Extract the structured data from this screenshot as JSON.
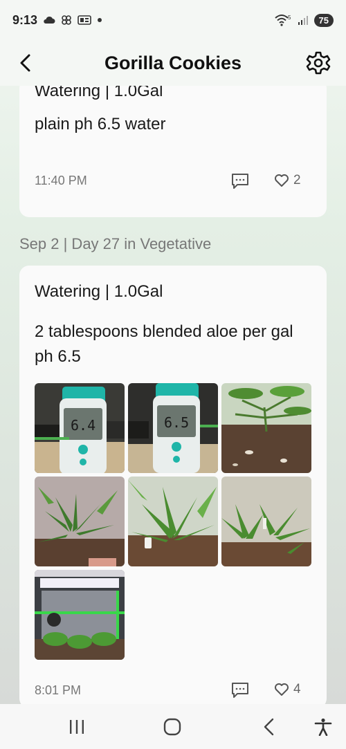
{
  "status_bar": {
    "time": "9:13",
    "signal_label": "5",
    "battery": "75"
  },
  "header": {
    "title": "Gorilla Cookies"
  },
  "entries": [
    {
      "title": "Watering | 1.0Gal",
      "note": "plain ph 6.5 water",
      "time": "11:40 PM",
      "likes": "2"
    },
    {
      "date_header": "Sep 2 | Day 27 in Vegetative",
      "title": "Watering | 1.0Gal",
      "note": "2 tablespoons blended aloe per gal ph 6.5",
      "time": "8:01 PM",
      "likes": "4",
      "photos": [
        {
          "subject": "ph meter reading 6.4",
          "meter_text": "6.4"
        },
        {
          "subject": "ph meter reading 6.5",
          "meter_text": "6.5"
        },
        {
          "subject": "plant stem base"
        },
        {
          "subject": "cannabis leaves"
        },
        {
          "subject": "cannabis plant with tag"
        },
        {
          "subject": "cannabis canopy"
        },
        {
          "subject": "grow tent interior"
        }
      ]
    }
  ],
  "colors": {
    "accent_green": "#4caf50",
    "meter_teal": "#1fb5a8"
  }
}
